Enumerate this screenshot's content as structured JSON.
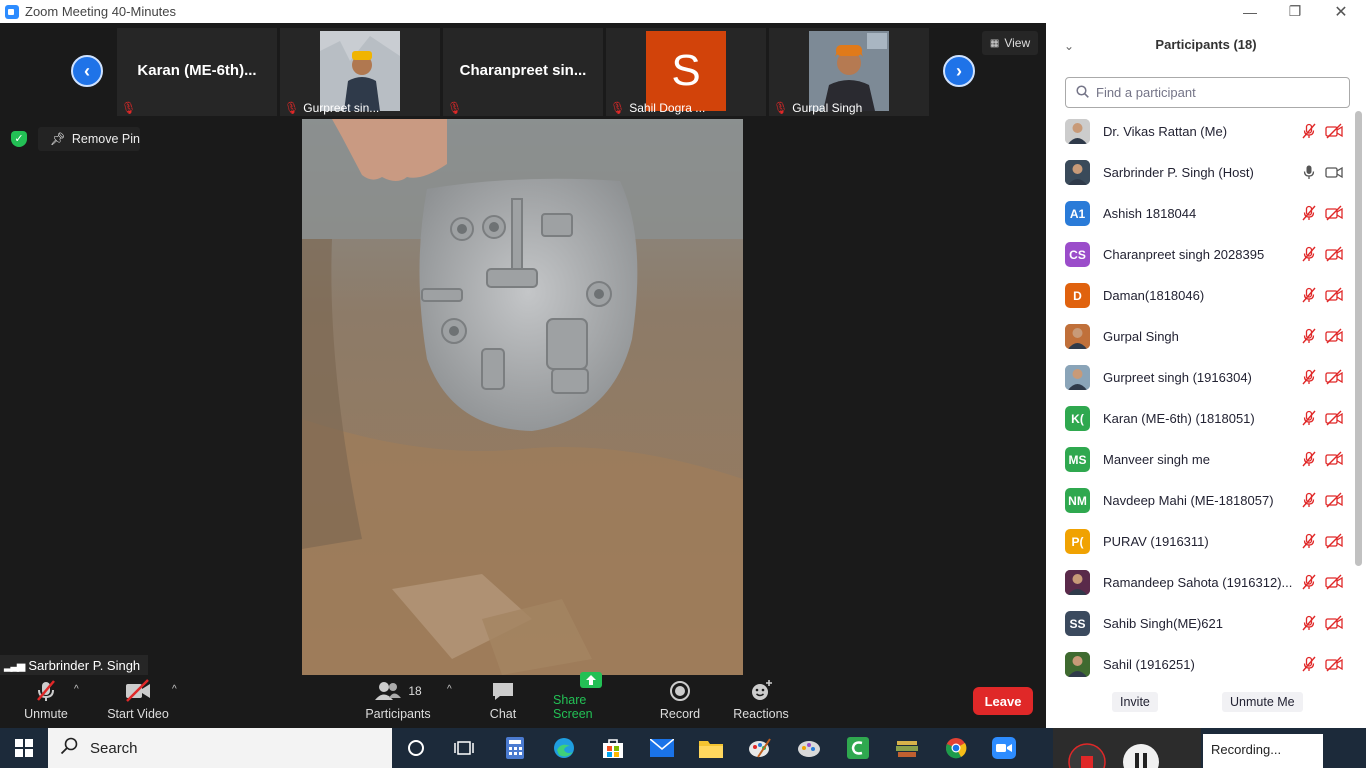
{
  "window": {
    "title": "Zoom Meeting 40-Minutes",
    "app_icon": "zoom-icon",
    "controls": [
      "minimize-icon",
      "restore-icon",
      "close-icon"
    ]
  },
  "top_strip": {
    "prev_icon": "chevron-left-icon",
    "next_icon": "chevron-right-icon",
    "view_label": "View",
    "thumbnails": [
      {
        "big_name": "Karan  (ME-6th)...",
        "caption": "",
        "muted": true
      },
      {
        "big_name": "",
        "caption": "Gurpreet sin...",
        "muted": true,
        "video": true
      },
      {
        "big_name": "Charanpreet  sin...",
        "caption": "",
        "muted": true
      },
      {
        "big_name": "",
        "caption": "Sahil Dogra ...",
        "muted": true,
        "avatar_letter": "S"
      },
      {
        "big_name": "",
        "caption": "Gurpal Singh",
        "muted": true,
        "video": true
      }
    ]
  },
  "main": {
    "remove_pin_label": "Remove Pin",
    "speaker_name": "Sarbrinder P. Singh"
  },
  "toolbar": {
    "unmute": "Unmute",
    "start_video": "Start Video",
    "participants": "Participants",
    "participants_count": "18",
    "chat": "Chat",
    "share_screen": "Share Screen",
    "record": "Record",
    "reactions": "Reactions",
    "leave": "Leave"
  },
  "panel": {
    "title": "Participants (18)",
    "search_placeholder": "Find a participant",
    "participants": [
      {
        "name": "Dr. Vikas Rattan (Me)",
        "initials": "",
        "color": "#cccccc",
        "photo": true,
        "muted": true,
        "video_off": true
      },
      {
        "name": "Sarbrinder P. Singh (Host)",
        "initials": "",
        "color": "#3a4a5a",
        "photo": true,
        "muted": false,
        "video_off": false
      },
      {
        "name": "Ashish 1818044",
        "initials": "A1",
        "color": "#2a7bd8",
        "muted": true,
        "video_off": true
      },
      {
        "name": "Charanpreet singh 2028395",
        "initials": "CS",
        "color": "#9b4dca",
        "muted": true,
        "video_off": true
      },
      {
        "name": "Daman(1818046)",
        "initials": "D",
        "color": "#e0620e",
        "muted": true,
        "video_off": true
      },
      {
        "name": "Gurpal Singh",
        "initials": "",
        "color": "#c0703a",
        "photo": true,
        "muted": true,
        "video_off": true
      },
      {
        "name": "Gurpreet singh (1916304)",
        "initials": "",
        "color": "#8aa4b8",
        "photo": true,
        "muted": true,
        "video_off": true
      },
      {
        "name": "Karan  (ME-6th) (1818051)",
        "initials": "K(",
        "color": "#2fa84f",
        "muted": true,
        "video_off": true
      },
      {
        "name": "Manveer singh me",
        "initials": "MS",
        "color": "#2fa84f",
        "muted": true,
        "video_off": true
      },
      {
        "name": "Navdeep Mahi (ME-1818057)",
        "initials": "NM",
        "color": "#2fa84f",
        "muted": true,
        "video_off": true
      },
      {
        "name": "PURAV (1916311)",
        "initials": "P(",
        "color": "#f0a202",
        "muted": true,
        "video_off": true
      },
      {
        "name": "Ramandeep Sahota (1916312)...",
        "initials": "",
        "color": "#5a2a4a",
        "photo": true,
        "muted": true,
        "video_off": true
      },
      {
        "name": "Sahib Singh(ME)621",
        "initials": "SS",
        "color": "#3b4a5e",
        "muted": true,
        "video_off": true
      },
      {
        "name": "Sahil (1916251)",
        "initials": "",
        "color": "#3f6a30",
        "photo": true,
        "muted": true,
        "video_off": true
      }
    ],
    "invite": "Invite",
    "unmute_me": "Unmute Me"
  },
  "taskbar": {
    "search_label": "Search",
    "recording_label": "Recording..."
  },
  "colors": {
    "accent_blue": "#1f73e8",
    "leave_red": "#e02828",
    "share_green": "#23c055",
    "muted_red": "#e02828"
  }
}
